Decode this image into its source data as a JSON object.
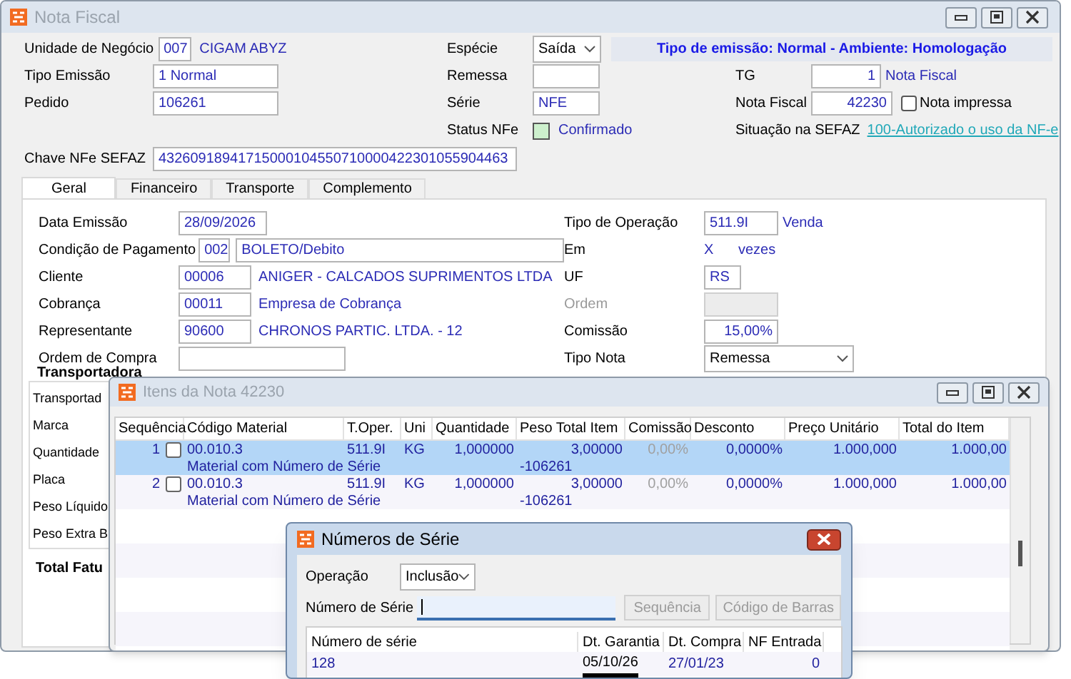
{
  "main_window": {
    "title": "Nota Fiscal",
    "left_fields": [
      {
        "label": "Unidade de Negócio",
        "kind": "code",
        "value": "007",
        "description": "CIGAM ABYZ"
      },
      {
        "label": "Tipo Emissão",
        "kind": "text",
        "value": "1 Normal"
      },
      {
        "label": "Pedido",
        "kind": "text",
        "value": "106261"
      }
    ],
    "middle_fields": [
      {
        "label": "Espécie",
        "kind": "select",
        "value": "Saída"
      },
      {
        "label": "Remessa",
        "kind": "text"
      },
      {
        "label": "Série",
        "kind": "text",
        "value": "NFE"
      },
      {
        "label": "Status NFe",
        "kind": "status",
        "value": "Confirmado"
      }
    ],
    "banner": "Tipo de emissão: Normal - Ambiente: Homologação",
    "right_fields": [
      {
        "label": "TG",
        "kind": "number",
        "value": "1",
        "description": "Nota Fiscal"
      },
      {
        "label": "Nota Fiscal",
        "kind": "number",
        "value": "42230",
        "checkbox": {
          "label": "Nota impressa",
          "checked": false
        }
      },
      {
        "label": "Situação na SEFAZ",
        "kind": "link",
        "value": "100-Autorizado o uso da NF-e"
      }
    ],
    "chave": {
      "label": "Chave NFe SEFAZ",
      "value": "43260918941715000104550710000422301055904463"
    },
    "tabs": [
      {
        "label": "Geral",
        "selected": true
      },
      {
        "label": "Financeiro",
        "selected": false
      },
      {
        "label": "Transporte",
        "selected": false
      },
      {
        "label": "Complemento",
        "selected": false
      }
    ],
    "geral_left": [
      {
        "label": "Data Emissão",
        "kind": "date",
        "value": "28/09/2026"
      },
      {
        "label": "Condição de Pagamento",
        "kind": "code_field",
        "code": "002",
        "value": "BOLETO/Debito"
      },
      {
        "label": "Cliente",
        "kind": "code_text",
        "code": "00006",
        "value": "ANIGER - CALCADOS SUPRIMENTOS LTDA"
      },
      {
        "label": "Cobrança",
        "kind": "code_text",
        "code": "00011",
        "value": "Empresa de Cobrança"
      },
      {
        "label": "Representante",
        "kind": "code_text",
        "code": "90600",
        "value": "CHRONOS PARTIC. LTDA. - 12"
      },
      {
        "label": "Ordem de Compra",
        "kind": "text"
      }
    ],
    "geral_right": [
      {
        "label": "Tipo de Operação",
        "kind": "code_text",
        "code": "511.9I",
        "value": "Venda"
      },
      {
        "label": "Em",
        "kind": "times",
        "value": "X",
        "unit": "vezes"
      },
      {
        "label": "UF",
        "kind": "short",
        "value": "RS"
      },
      {
        "label": "Ordem",
        "kind": "text",
        "disabled": true
      },
      {
        "label": "Comissão",
        "kind": "number",
        "value": "15,00%"
      },
      {
        "label": "Tipo Nota",
        "kind": "select",
        "value": "Remessa"
      }
    ],
    "transportadora": {
      "title": "Transportadora",
      "labels": [
        "Transportad",
        "Marca",
        "Quantidade",
        "Placa",
        "Peso Líquido",
        "Peso Extra B"
      ],
      "total_label": "Total Fatu"
    }
  },
  "items_window": {
    "title": "Itens da Nota 42230",
    "columns": [
      "Sequência",
      "Código Material",
      "T.Oper.",
      "Uni",
      "Quantidade",
      "Peso Total Item",
      "Comissão",
      "Desconto",
      "Preço Unitário",
      "Total do Item"
    ],
    "rows": [
      {
        "selected": true,
        "checked": false,
        "sequence": "1",
        "code": "00.010.3",
        "description": "Material com Número de Série",
        "operation": "511.9I",
        "unit": "KG",
        "quantity": "1,000000",
        "weight": "3,00000",
        "weight_note": "-106261",
        "commission": "0,00%",
        "discount": "0,0000%",
        "unit_price": "1.000,000",
        "total": "1.000,00"
      },
      {
        "selected": false,
        "checked": false,
        "sequence": "2",
        "code": "00.010.3",
        "description": "Material com Número de Série",
        "operation": "511.9I",
        "unit": "KG",
        "quantity": "1,000000",
        "weight": "3,00000",
        "weight_note": "-106261",
        "commission": "0,00%",
        "discount": "0,0000%",
        "unit_price": "1.000,000",
        "total": "1.000,00"
      }
    ]
  },
  "serial_dialog": {
    "title": "Números de Série",
    "operation": {
      "label": "Operação",
      "value": "Inclusão"
    },
    "serial_field": {
      "label": "Número de Série"
    },
    "buttons": [
      {
        "label": "Sequência",
        "disabled": true
      },
      {
        "label": "Código de Barras",
        "disabled": true
      }
    ],
    "columns": [
      "Número de série",
      "Dt. Garantia",
      "Dt. Compra",
      "NF Entrada"
    ],
    "rows": [
      {
        "serial": "128",
        "warranty_date": "05/10/26",
        "purchase_date": "27/01/23",
        "nf_entrada": "0"
      }
    ]
  }
}
